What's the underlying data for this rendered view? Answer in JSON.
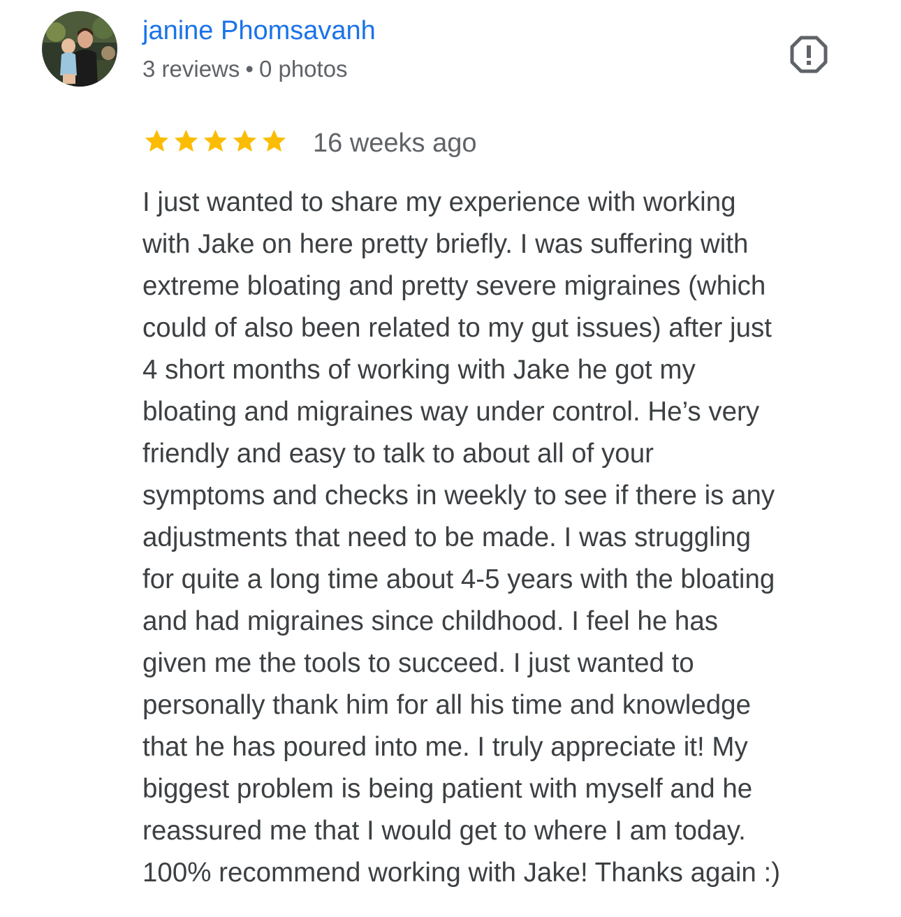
{
  "reviewer": {
    "name": "janine Phomsavanh",
    "reviews": "3 reviews",
    "separator": "•",
    "photos": "0 photos",
    "avatar_icon": "user-photo-avatar"
  },
  "report_icon": "report-octagon-exclamation-icon",
  "rating": {
    "stars": 5,
    "max": 5,
    "star_color": "#fbbc04"
  },
  "time": "16 weeks ago",
  "review_lines": [
    "I just wanted to share my experience with working",
    "with Jake on here pretty briefly. I was suffering with",
    "extreme bloating and pretty severe migraines (which",
    "could of also been related to my gut issues) after just",
    "4 short months of working with Jake he got my",
    "bloating and migraines way under control. He’s very",
    "friendly and easy to talk to about all of your",
    "symptoms and checks in weekly to see if there is any",
    "adjustments that need to be made. I was struggling",
    "for quite a long time about 4-5 years with the bloating",
    "and had migraines since childhood. I feel he has",
    "given me the tools to succeed. I just wanted to",
    "personally thank him for all his time and knowledge",
    "that he has poured into me. I truly appreciate it! My",
    "biggest problem is being patient with myself and he",
    "reassured me that I would get to where I am today.",
    "100% recommend working with Jake! Thanks again :)"
  ],
  "colors": {
    "name": "#1a73e8",
    "meta": "#5f6368",
    "body": "#3c4043",
    "star": "#fbbc04"
  }
}
